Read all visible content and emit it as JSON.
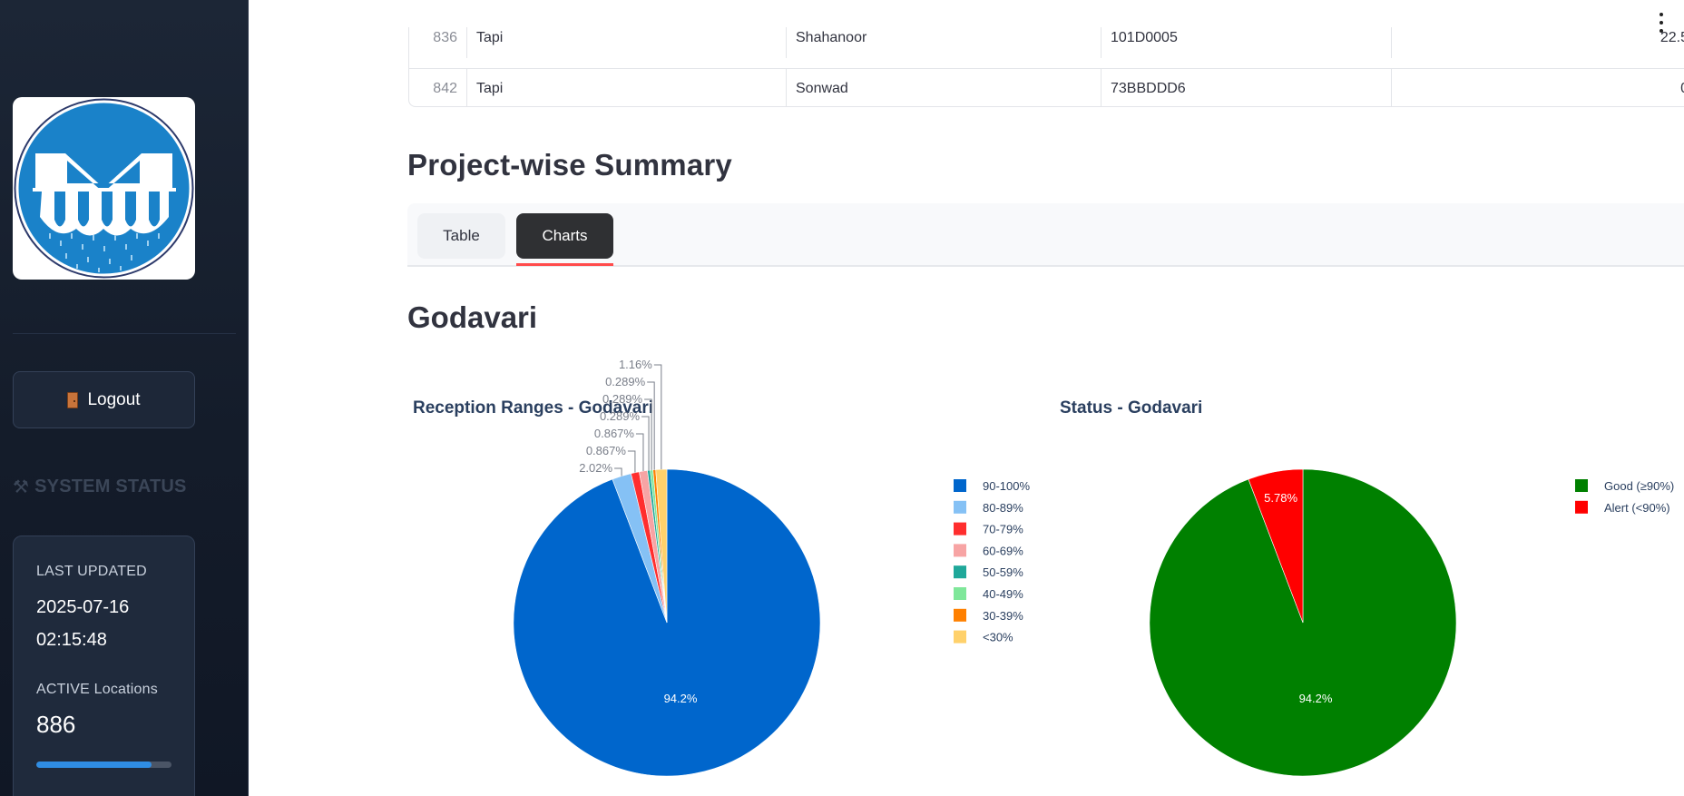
{
  "sidebar": {
    "logout_label": "Logout",
    "system_status_label": "SYSTEM STATUS",
    "last_updated_label": "LAST UPDATED",
    "last_updated_date": "2025-07-16",
    "last_updated_time": "02:15:48",
    "active_locations_label": "ACTIVE Locations",
    "active_locations_count": "886",
    "active_progress_fraction": 0.85
  },
  "table": {
    "rows": [
      [
        "836",
        "Tapi",
        "Shahanoor",
        "101D0005",
        "22.5"
      ],
      [
        "842",
        "Tapi",
        "Sonwad",
        "73BBDDD6",
        "0"
      ]
    ]
  },
  "section": {
    "title": "Project-wise Summary",
    "tabs": [
      "Table",
      "Charts"
    ],
    "active_tab": "Charts",
    "subtitle": "Godavari"
  },
  "colors": {
    "accent_tab_underline": "#ff4b4b",
    "logo_blue": "#1a82c9"
  },
  "chart_data": [
    {
      "type": "pie",
      "title": "Reception Ranges - Godavari",
      "categories": [
        "90-100%",
        "80-89%",
        "70-79%",
        "60-69%",
        "50-59%",
        "40-49%",
        "30-39%",
        "<30%"
      ],
      "values": [
        94.2,
        2.02,
        0.867,
        0.867,
        0.289,
        0.289,
        0.289,
        1.16
      ],
      "labels": [
        "94.2%",
        "2.02%",
        "0.867%",
        "0.867%",
        "0.289%",
        "0.289%",
        "0.289%",
        "1.16%"
      ],
      "colors": [
        "#0066cc",
        "#85c1f5",
        "#ff2e2e",
        "#f7a4a4",
        "#1fa89a",
        "#7fe79a",
        "#ff8000",
        "#ffd16b"
      ],
      "legend_position": "right"
    },
    {
      "type": "pie",
      "title": "Status - Godavari",
      "categories": [
        "Good (≥90%)",
        "Alert (<90%)"
      ],
      "values": [
        94.2,
        5.78
      ],
      "labels": [
        "94.2%",
        "5.78%"
      ],
      "colors": [
        "#008000",
        "#ff0000"
      ],
      "legend_position": "right"
    }
  ]
}
